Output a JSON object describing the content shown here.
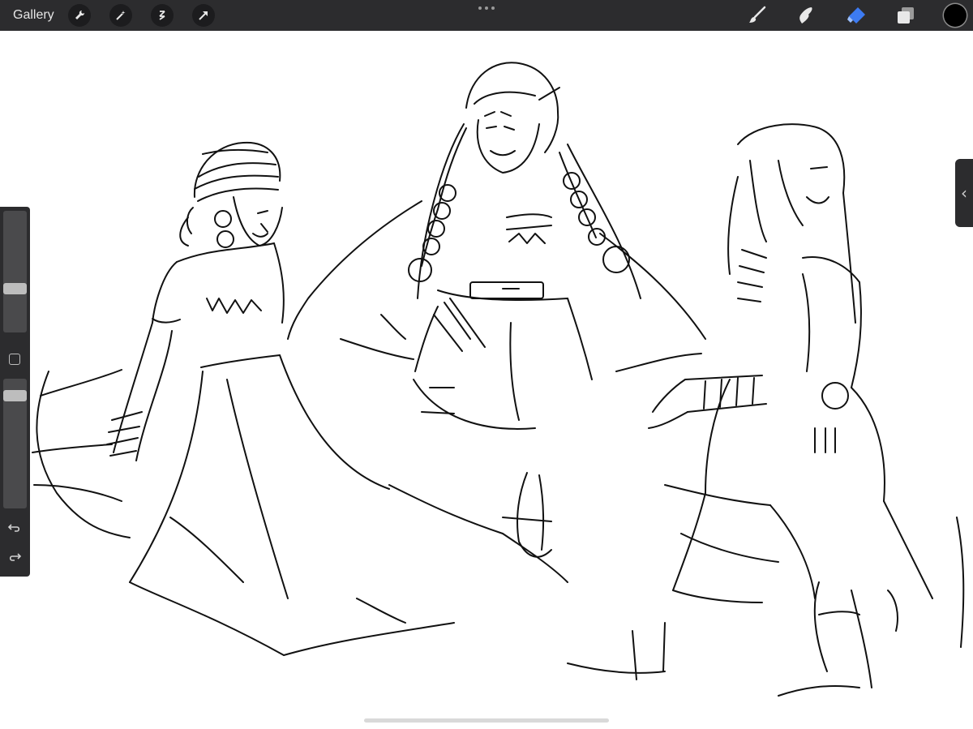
{
  "toolbar": {
    "gallery_label": "Gallery",
    "left_icons": [
      "wrench-icon",
      "magic-wand-icon",
      "selection-icon",
      "transform-arrow-icon"
    ],
    "more_icon": "more-dots-icon",
    "right_tools": [
      "brush-icon",
      "smudge-icon",
      "eraser-icon",
      "layers-icon"
    ],
    "active_tool": "eraser-icon",
    "active_tool_color": "#3d7bf2",
    "current_color": "#000000"
  },
  "sidebar": {
    "size_slider_label": "brush-size-slider",
    "opacity_slider_label": "opacity-slider",
    "icons": [
      "modify-square-icon",
      "undo-icon",
      "redo-icon"
    ]
  },
  "right_tab": {
    "glyph": "‹"
  },
  "canvas": {
    "background": "#ffffff",
    "stroke_color": "#111111"
  }
}
